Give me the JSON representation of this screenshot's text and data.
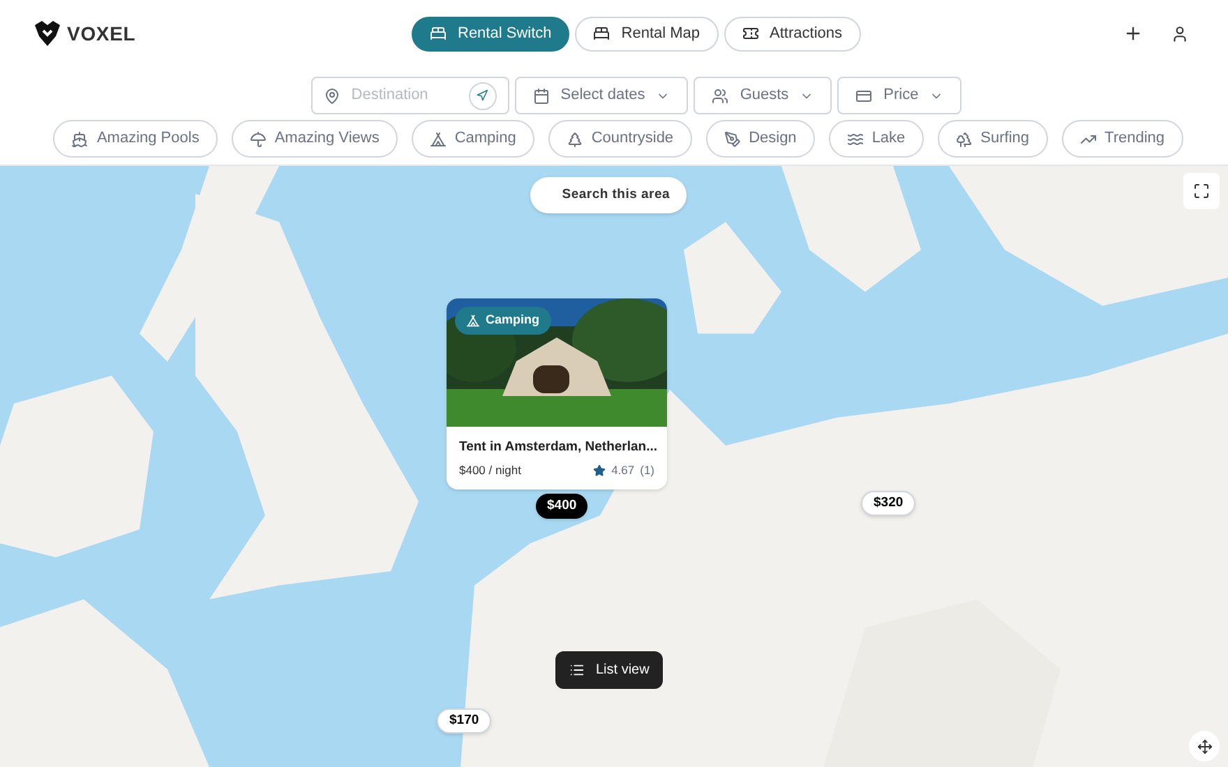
{
  "brand": {
    "name": "VOXEL"
  },
  "nav_tabs": [
    {
      "label": "Rental Switch",
      "selected": true
    },
    {
      "label": "Rental Map",
      "selected": false
    },
    {
      "label": "Attractions",
      "selected": false
    }
  ],
  "search": {
    "destination_placeholder": "Destination",
    "dates": "Select dates",
    "guests": "Guests",
    "price": "Price"
  },
  "categories": [
    {
      "label": "Amazing Pools"
    },
    {
      "label": "Amazing Views"
    },
    {
      "label": "Camping"
    },
    {
      "label": "Countryside"
    },
    {
      "label": "Design"
    },
    {
      "label": "Lake"
    },
    {
      "label": "Surfing"
    },
    {
      "label": "Trending"
    }
  ],
  "map": {
    "search_area": "Search this area",
    "list_view": "List view",
    "listing": {
      "category": "Camping",
      "title": "Tent in Amsterdam, Netherlan...",
      "price": "$400 / night",
      "rating": "4.67",
      "reviews": "(1)"
    },
    "price_pins": [
      {
        "label": "$400",
        "selected": true
      },
      {
        "label": "$320",
        "selected": false
      },
      {
        "label": "$170",
        "selected": false
      }
    ]
  }
}
